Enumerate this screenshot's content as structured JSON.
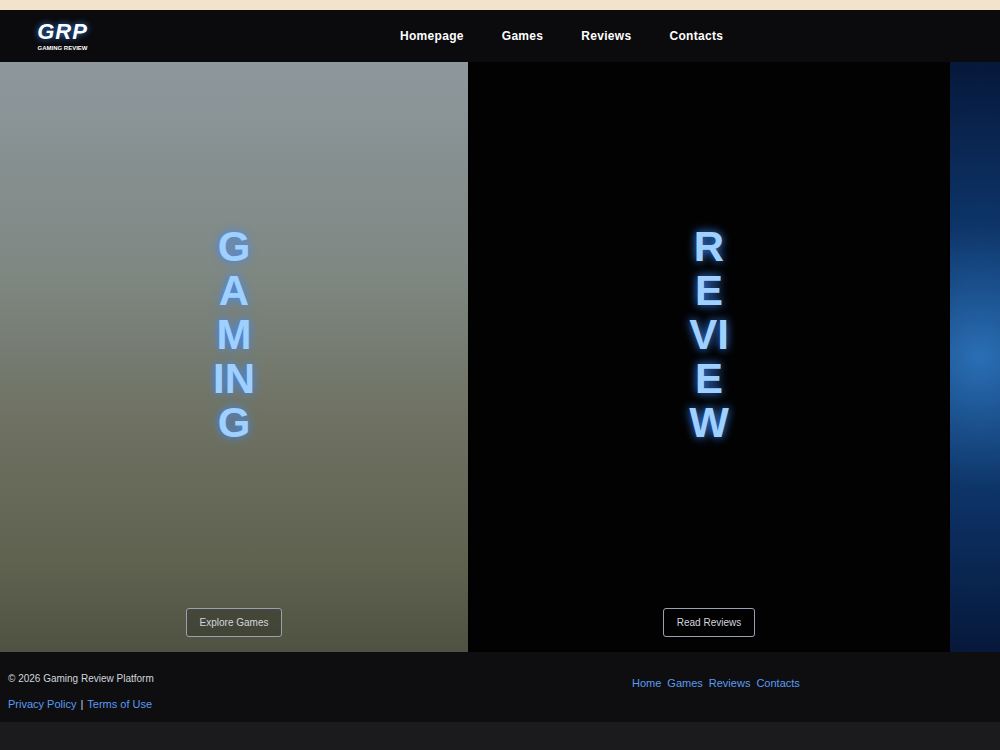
{
  "header": {
    "logo": {
      "mark": "GRP",
      "name": "GAMING REVIEW"
    },
    "nav": [
      {
        "label": "Homepage"
      },
      {
        "label": "Games"
      },
      {
        "label": "Reviews"
      },
      {
        "label": "Contacts"
      }
    ]
  },
  "panels": [
    {
      "kind": "photo",
      "title": "GAMING",
      "button": "Explore Games"
    },
    {
      "kind": "dark",
      "title": "REVIEW",
      "button": "Read Reviews"
    }
  ],
  "footer": {
    "copyright": "© 2026 Gaming Review Platform",
    "legal": [
      "Privacy Policy",
      "Terms of Use"
    ],
    "separator": "|",
    "links": [
      "Home",
      "Games",
      "Reviews",
      "Contacts"
    ]
  }
}
